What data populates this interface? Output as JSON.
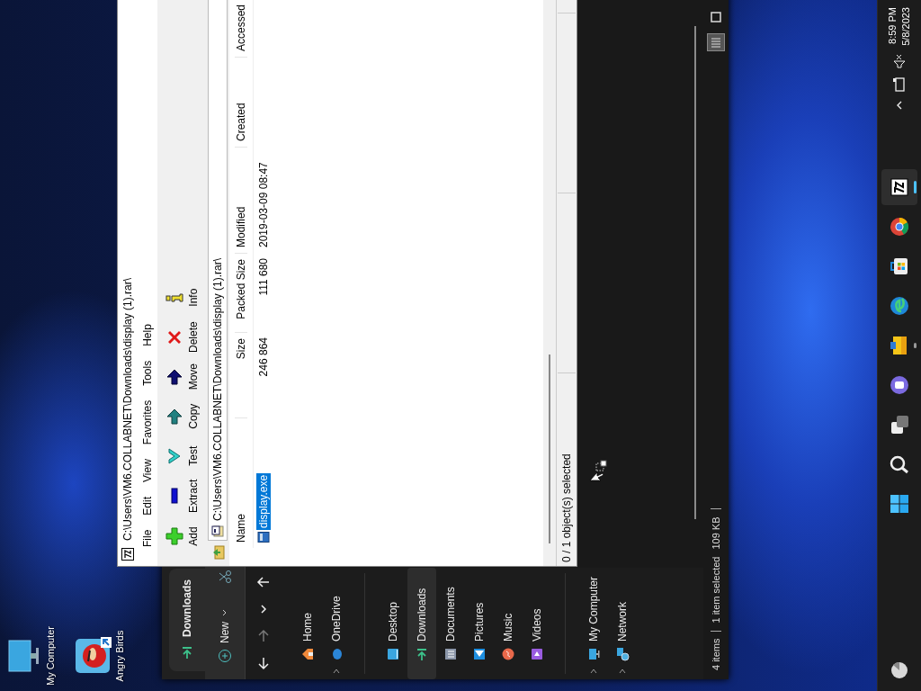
{
  "desktop_icons": [
    {
      "label": "My Computer",
      "kind": "computer",
      "shortcut": false
    },
    {
      "label": "Angry Birds",
      "kind": "game",
      "shortcut": true
    }
  ],
  "explorer": {
    "tab": "Downloads",
    "new_label": "New",
    "nav": [
      {
        "kind": "back",
        "disabled": false
      },
      {
        "kind": "forward",
        "disabled": true
      },
      {
        "kind": "recent",
        "disabled": false
      },
      {
        "kind": "up",
        "disabled": false
      }
    ],
    "sidebar_groups": [
      [
        {
          "label": "Home",
          "kind": "home",
          "expandable": false,
          "selected": false
        },
        {
          "label": "OneDrive",
          "kind": "cloud",
          "expandable": true,
          "selected": false
        }
      ],
      [
        {
          "label": "Desktop",
          "kind": "desktop",
          "expandable": false,
          "selected": false
        },
        {
          "label": "Downloads",
          "kind": "downloads",
          "expandable": false,
          "selected": true
        },
        {
          "label": "Documents",
          "kind": "documents",
          "expandable": false,
          "selected": false
        },
        {
          "label": "Pictures",
          "kind": "pictures",
          "expandable": false,
          "selected": false
        },
        {
          "label": "Music",
          "kind": "music",
          "expandable": false,
          "selected": false
        },
        {
          "label": "Videos",
          "kind": "videos",
          "expandable": false,
          "selected": false
        }
      ],
      [
        {
          "label": "My Computer",
          "kind": "computer",
          "expandable": true,
          "selected": false
        },
        {
          "label": "Network",
          "kind": "network",
          "expandable": true,
          "selected": false
        }
      ]
    ],
    "status": {
      "items": "4 items",
      "selection": "1 item selected",
      "size": "109 KB"
    },
    "views": [
      {
        "kind": "details",
        "selected": true
      },
      {
        "kind": "tiles",
        "selected": false
      }
    ]
  },
  "archive": {
    "title": "C:\\Users\\VM6.COLLABNET\\Downloads\\display (1).rar\\",
    "menu": [
      "File",
      "Edit",
      "View",
      "Favorites",
      "Tools",
      "Help"
    ],
    "toolbar": [
      {
        "label": "Add",
        "kind": "add"
      },
      {
        "label": "Extract",
        "kind": "extract"
      },
      {
        "label": "Test",
        "kind": "test"
      },
      {
        "label": "Copy",
        "kind": "copy"
      },
      {
        "label": "Move",
        "kind": "move"
      },
      {
        "label": "Delete",
        "kind": "delete"
      },
      {
        "label": "Info",
        "kind": "info"
      }
    ],
    "path": "C:\\Users\\VM6.COLLABNET\\Downloads\\display (1).rar\\",
    "columns": [
      "Name",
      "Size",
      "Packed Size",
      "Modified",
      "Created",
      "Accessed"
    ],
    "rows": [
      {
        "name": "display.exe",
        "size": "246 864",
        "packed_size": "111 680",
        "modified": "2019-03-09 08:47",
        "selected": true
      }
    ],
    "status": "0 / 1 object(s) selected"
  },
  "taskbar": {
    "apps": [
      {
        "kind": "start",
        "running": false,
        "selected": false
      },
      {
        "kind": "search",
        "running": false,
        "selected": false
      },
      {
        "kind": "taskview",
        "running": false,
        "selected": false
      },
      {
        "kind": "chat",
        "running": false,
        "selected": false
      },
      {
        "kind": "explorer",
        "running": true,
        "selected": false
      },
      {
        "kind": "edge",
        "running": false,
        "selected": false
      },
      {
        "kind": "store",
        "running": false,
        "selected": false
      },
      {
        "kind": "chrome",
        "running": false,
        "selected": false
      },
      {
        "kind": "archiver",
        "running": true,
        "selected": true
      }
    ],
    "clock": {
      "time": "8:59 PM",
      "date": "5/8/2023"
    }
  }
}
